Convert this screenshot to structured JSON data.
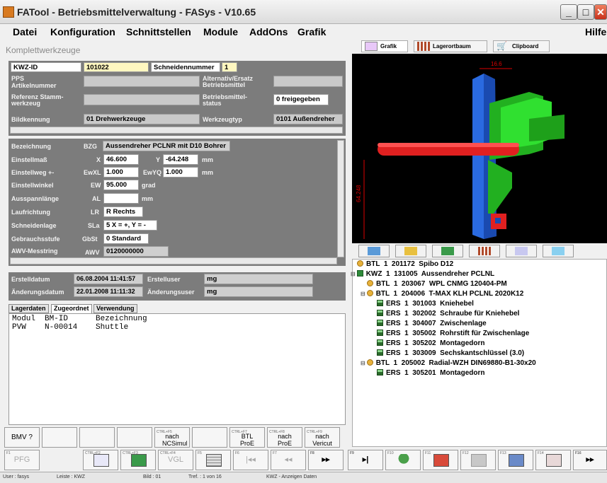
{
  "window": {
    "title": "FATool - Betriebsmittelverwaltung - FASys - V10.65",
    "minimize": "_",
    "maximize": "□",
    "close": "✕"
  },
  "menu": [
    "Datei",
    "Konfiguration",
    "Schnittstellen",
    "Module",
    "AddOns",
    "Grafik",
    "Hilfe"
  ],
  "form": {
    "header": "Komplettwerkzeuge",
    "kwz_id_label": "KWZ-ID",
    "kwz_id": "101022",
    "schneidennummer_label": "Schneidennummer",
    "schneidennummer": "1",
    "pps_label": "PPS",
    "artikelnummer_label": "Artikelnummer",
    "alternativ_label": "Alternativ/Ersatz Betriebsmittel",
    "referenz_label": "Referenz Stamm-werkzeug",
    "status_label": "Betriebsmittel-status",
    "status_value": "0 freigegeben",
    "bildkennung_label": "Bildkennung",
    "bildkennung": "01 Drehwerkzeuge",
    "werkzeugtyp_label": "Werkzeugtyp",
    "werkzeugtyp": "0101 Außendreher"
  },
  "details": {
    "bezeichnung_label": "Bezeichnung",
    "bezeichnung_code": "BZG",
    "bezeichnung": "Aussendreher PCLNR mit D10 Bohrer",
    "einstellmass_label": "Einstellmaß",
    "x_label": "X",
    "x_value": "46.600",
    "y_label": "Y",
    "y_value": "-64.248",
    "unit_mm": "mm",
    "einstellweg_label": "Einstellweg +-",
    "ewxl_label": "EwXL",
    "ewxl": "1.000",
    "ewyq_label": "EwYQ",
    "ewyq": "1.000",
    "einstellwinkel_label": "Einstellwinkel",
    "ew_label": "EW",
    "ew": "95.000",
    "unit_grad": "grad",
    "auspann_label": "Ausspannlänge",
    "al_label": "AL",
    "laufrichtung_label": "Laufrichtung",
    "lr_label": "LR",
    "lr": "R Rechts",
    "schneidenlage_label": "Schneidenlage",
    "sla_label": "SLa",
    "sla": "5 X = +, Y = -",
    "gebrauch_label": "Gebrauchsstufe",
    "gbst_label": "GbSt",
    "gbst": "0 Standard",
    "awv_label": "AWV-Messtring",
    "awv_code": "AWV",
    "awv": "0120000000"
  },
  "audit": {
    "erstelldatum_label": "Erstelldatum",
    "erstelldatum": "06.08.2004 11:41:57",
    "erstelluser_label": "Erstelluser",
    "erstelluser": "mg",
    "aenderungsdatum_label": "Änderungsdatum",
    "aenderungsdatum": "22.01.2008 11:11:32",
    "aenderungsuser_label": "Änderungsuser",
    "aenderungsuser": "mg"
  },
  "tabs": [
    "Lagerdaten",
    "Zugeordnet",
    "Verwendung"
  ],
  "grid": {
    "columns": [
      "Modul",
      "BM-ID",
      "Bezeichnung"
    ],
    "rows": [
      [
        "PVW",
        "N-00014",
        "Shuttle"
      ]
    ]
  },
  "fkeys": [
    {
      "small": "",
      "label": "BMV ?"
    },
    {
      "small": "",
      "label": ""
    },
    {
      "small": "",
      "label": ""
    },
    {
      "small": "",
      "label": ""
    },
    {
      "small": "CTRL+F5",
      "label": "nach NCSimul"
    },
    {
      "small": "",
      "label": ""
    },
    {
      "small": "CTRL+F7",
      "label": "BTL ProE"
    },
    {
      "small": "CTRL+F8",
      "label": "nach ProE"
    },
    {
      "small": "CTRL+F9",
      "label": "nach Vericut"
    }
  ],
  "toolbar": [
    {
      "small": "F1",
      "label": "PFG"
    },
    {
      "small": "CTRL+F2",
      "label": ""
    },
    {
      "small": "CTRL+F3",
      "label": ""
    },
    {
      "small": "CTRL+F4",
      "label": "VGL"
    },
    {
      "small": "F5",
      "label": ""
    },
    {
      "small": "F6",
      "label": "|◂◂"
    },
    {
      "small": "F7",
      "label": "◂◂"
    },
    {
      "small": "F8",
      "label": "▸▸"
    },
    {
      "small": "F9",
      "label": "▸|"
    },
    {
      "small": "F10",
      "label": ""
    },
    {
      "small": "F11",
      "label": ""
    },
    {
      "small": "F12",
      "label": ""
    },
    {
      "small": "F13",
      "label": ""
    },
    {
      "small": "F14",
      "label": ""
    },
    {
      "small": "F15",
      "label": ""
    },
    {
      "small": "F16",
      "label": "▸▸"
    }
  ],
  "status": {
    "user": "User : fasys",
    "leiste": "Leiste : KWZ",
    "bild": "Bild : 01",
    "treffer": "Tref. : 1 von 16",
    "info": "KWZ - Anzeigen Daten"
  },
  "right_tabs": [
    "Grafik",
    "Lagerortbaum",
    "Clipboard"
  ],
  "viewer": {
    "dim_top": "16.6",
    "dim_side": "64.248"
  },
  "tree": [
    {
      "indent": 0,
      "type": "btl",
      "text": "BTL  1  201172  Spibo D12"
    },
    {
      "indent": 0,
      "type": "kwz",
      "text": "KWZ  1  131005  Aussendreher PCLNL",
      "expander": "⊟"
    },
    {
      "indent": 1,
      "type": "btl",
      "text": "BTL  1  203067  WPL CNMG 120404-PM"
    },
    {
      "indent": 1,
      "type": "btl",
      "text": "BTL  1  204006  T-MAX KLH PCLNL 2020K12",
      "expander": "⊟"
    },
    {
      "indent": 2,
      "type": "ers",
      "text": "ERS  1  301003  Kniehebel"
    },
    {
      "indent": 2,
      "type": "ers",
      "text": "ERS  1  302002  Schraube für Kniehebel"
    },
    {
      "indent": 2,
      "type": "ers",
      "text": "ERS  1  304007  Zwischenlage"
    },
    {
      "indent": 2,
      "type": "ers",
      "text": "ERS  1  305002  Rohrstift für Zwischenlage"
    },
    {
      "indent": 2,
      "type": "ers",
      "text": "ERS  1  305202  Montagedorn"
    },
    {
      "indent": 2,
      "type": "ers",
      "text": "ERS  1  303009  Sechskantschlüssel (3.0)"
    },
    {
      "indent": 1,
      "type": "btl",
      "text": "BTL  1  205002  Radial-WZH DIN69880-B1-30x20",
      "expander": "⊟"
    },
    {
      "indent": 2,
      "type": "ers",
      "text": "ERS  1  305201  Montagedorn"
    }
  ]
}
